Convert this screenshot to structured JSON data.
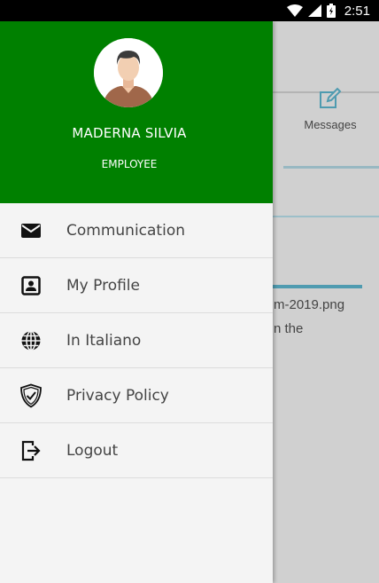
{
  "status_bar": {
    "time": "2:51"
  },
  "drawer": {
    "header": {
      "user_name": "MADERNA SILVIA",
      "user_role": "EMPLOYEE",
      "header_color": "#008000"
    },
    "menu": [
      {
        "label": "Communication",
        "icon": "envelope-icon"
      },
      {
        "label": "My Profile",
        "icon": "profile-card-icon"
      },
      {
        "label": "In Italiano",
        "icon": "globe-icon"
      },
      {
        "label": "Privacy Policy",
        "icon": "shield-check-icon"
      },
      {
        "label": "Logout",
        "icon": "logout-icon"
      }
    ]
  },
  "background": {
    "tab_label": "Messages",
    "line1": "m-2019.png",
    "line2": "n the"
  }
}
